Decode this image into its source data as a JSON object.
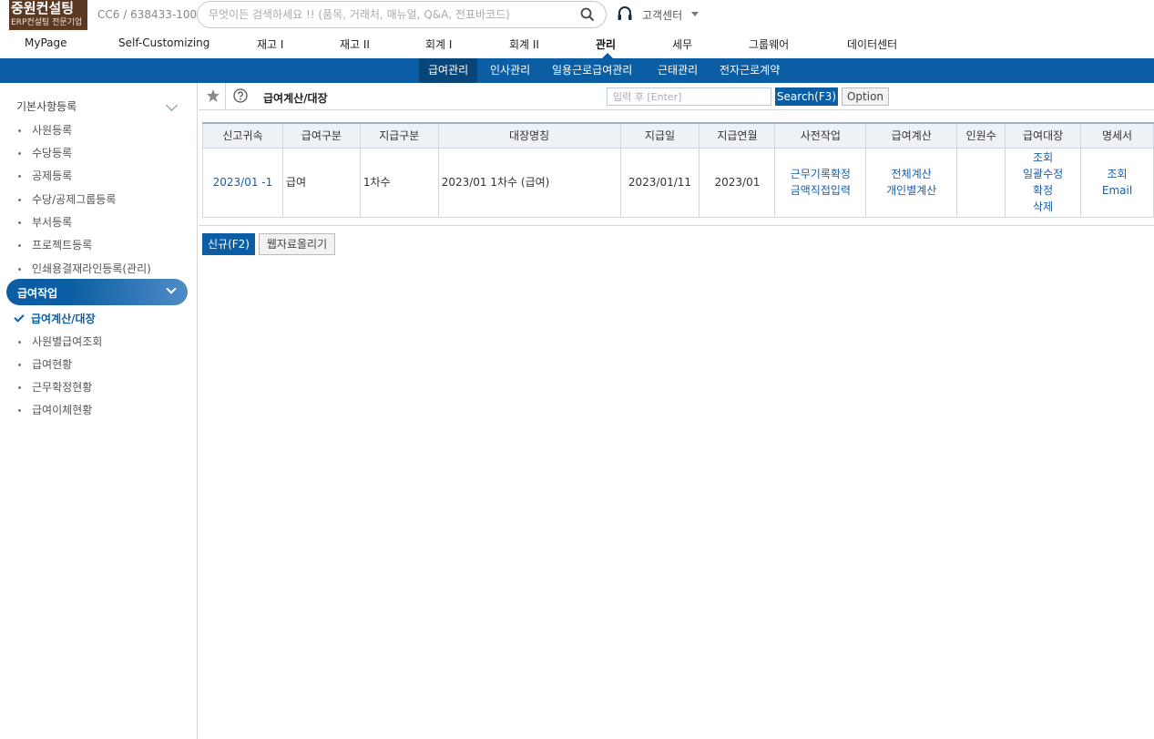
{
  "logo": {
    "line1": "중원컨설팅",
    "line2": "ERP컨설팅 전문기업"
  },
  "company": "CC6 / 638433-100",
  "search": {
    "placeholder": "무엇이든 검색하세요 !! (품목, 거래처, 매뉴얼, Q&A, 전표바코드)"
  },
  "customer_center": "고객센터",
  "main_menu": [
    "MyPage",
    "Self-Customizing",
    "재고 I",
    "재고 II",
    "회계 I",
    "회계 II",
    "관리",
    "세무",
    "그룹웨어",
    "데이터센터"
  ],
  "main_menu_active": "관리",
  "sub_menu": [
    "급여관리",
    "인사관리",
    "일용근로급여관리",
    "근태관리",
    "전자근로계약"
  ],
  "sub_menu_active": "급여관리",
  "sidebar": {
    "section1": "기본사항등록",
    "section1_items": [
      "사원등록",
      "수당등록",
      "공제등록",
      "수당/공제그룹등록",
      "부서등록",
      "프로젝트등록",
      "인쇄용결재라인등록(관리)"
    ],
    "group": "급여작업",
    "active_item": "급여계산/대장",
    "group_items": [
      "사원별급여조회",
      "급여현황",
      "근무확정현황",
      "급여이체현황"
    ]
  },
  "toolbar": {
    "title": "급여계산/대장",
    "input_placeholder": "입력 후 [Enter]",
    "search_label": "Search(F3)",
    "option_label": "Option"
  },
  "table": {
    "headers": [
      "신고귀속",
      "급여구분",
      "지급구분",
      "대장명칭",
      "지급일",
      "지급연월",
      "사전작업",
      "급여계산",
      "인원수",
      "급여대장",
      "명세서"
    ],
    "row": {
      "report_period": "2023/01 -1",
      "pay_type": "급여",
      "payment_type": "1차수",
      "ledger_name": "2023/01 1차수 (급여)",
      "pay_date": "2023/01/11",
      "pay_month": "2023/01",
      "pre_work": [
        "근무기록확정",
        "금액직접입력"
      ],
      "calc": [
        "전체계산",
        "개인별계산"
      ],
      "headcount": "",
      "ledger": [
        "조회",
        "일괄수정",
        "확정",
        "삭제"
      ],
      "statement": [
        "조회",
        "Email"
      ]
    }
  },
  "buttons": {
    "new": "신규(F2)",
    "web_upload": "웹자료올리기"
  },
  "colors": {
    "primary": "#0b5ea3",
    "logo_bg": "#5b3a24"
  }
}
